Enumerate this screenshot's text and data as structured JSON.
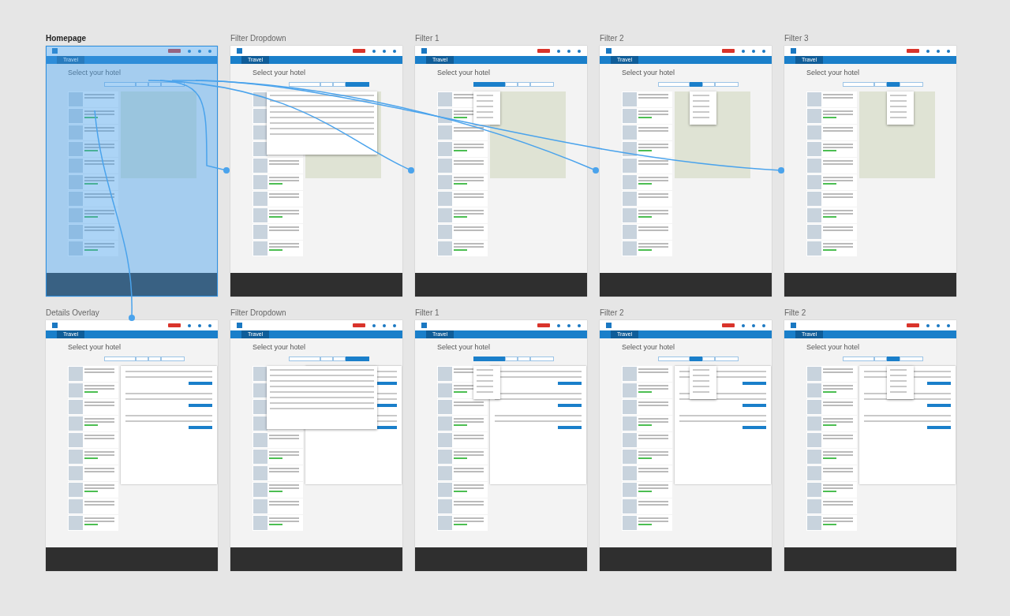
{
  "artboards": [
    {
      "title": "Homepage",
      "selected": true,
      "tab_label": "Travel",
      "heading": "Select your hotel",
      "show_map": true,
      "show_details": false,
      "dropdown_open": false,
      "filter_menu_open": false,
      "filter_buttons": [
        {
          "selected": false
        },
        {
          "selected": false
        },
        {
          "selected": false
        },
        {
          "selected": false
        }
      ]
    },
    {
      "title": "Filter Dropdown",
      "selected": false,
      "tab_label": "Travel",
      "heading": "Select your hotel",
      "show_map": true,
      "show_details": false,
      "dropdown_open": true,
      "filter_menu_open": false,
      "filter_buttons": [
        {
          "selected": false
        },
        {
          "selected": false
        },
        {
          "selected": false
        },
        {
          "selected": true
        }
      ]
    },
    {
      "title": "Filter 1",
      "selected": false,
      "tab_label": "Travel",
      "heading": "Select your hotel",
      "show_map": true,
      "show_details": false,
      "dropdown_open": false,
      "filter_menu_open": true,
      "filter_buttons": [
        {
          "selected": true
        },
        {
          "selected": false
        },
        {
          "selected": false
        },
        {
          "selected": false
        }
      ]
    },
    {
      "title": "Filter 2",
      "selected": false,
      "tab_label": "Travel",
      "heading": "Select your hotel",
      "show_map": true,
      "show_details": false,
      "dropdown_open": false,
      "filter_menu_open": true,
      "filter_buttons": [
        {
          "selected": false
        },
        {
          "selected": true
        },
        {
          "selected": false
        },
        {
          "selected": false
        }
      ]
    },
    {
      "title": "Filter 3",
      "selected": false,
      "tab_label": "Travel",
      "heading": "Select your hotel",
      "show_map": true,
      "show_details": false,
      "dropdown_open": false,
      "filter_menu_open": true,
      "filter_buttons": [
        {
          "selected": false
        },
        {
          "selected": false
        },
        {
          "selected": true
        },
        {
          "selected": false
        }
      ]
    },
    {
      "title": "Details Overlay",
      "selected": false,
      "tab_label": "Travel",
      "heading": "Select your hotel",
      "show_map": false,
      "show_details": true,
      "dropdown_open": false,
      "filter_menu_open": false,
      "filter_buttons": [
        {
          "selected": false
        },
        {
          "selected": false
        },
        {
          "selected": false
        },
        {
          "selected": false
        }
      ]
    },
    {
      "title": "Filter Dropdown",
      "selected": false,
      "tab_label": "Travel",
      "heading": "Select your hotel",
      "show_map": false,
      "show_details": true,
      "dropdown_open": true,
      "filter_menu_open": false,
      "filter_buttons": [
        {
          "selected": false
        },
        {
          "selected": false
        },
        {
          "selected": false
        },
        {
          "selected": true
        }
      ]
    },
    {
      "title": "Filter 1",
      "selected": false,
      "tab_label": "Travel",
      "heading": "Select your hotel",
      "show_map": false,
      "show_details": true,
      "dropdown_open": false,
      "filter_menu_open": true,
      "filter_buttons": [
        {
          "selected": true
        },
        {
          "selected": false
        },
        {
          "selected": false
        },
        {
          "selected": false
        }
      ]
    },
    {
      "title": "Filter 2",
      "selected": false,
      "tab_label": "Travel",
      "heading": "Select your hotel",
      "show_map": false,
      "show_details": true,
      "dropdown_open": false,
      "filter_menu_open": true,
      "filter_buttons": [
        {
          "selected": false
        },
        {
          "selected": true
        },
        {
          "selected": false
        },
        {
          "selected": false
        }
      ]
    },
    {
      "title": "Filte 2",
      "selected": false,
      "tab_label": "Travel",
      "heading": "Select your hotel",
      "show_map": false,
      "show_details": true,
      "dropdown_open": false,
      "filter_menu_open": true,
      "filter_buttons": [
        {
          "selected": false
        },
        {
          "selected": false
        },
        {
          "selected": true
        },
        {
          "selected": false
        }
      ]
    }
  ]
}
